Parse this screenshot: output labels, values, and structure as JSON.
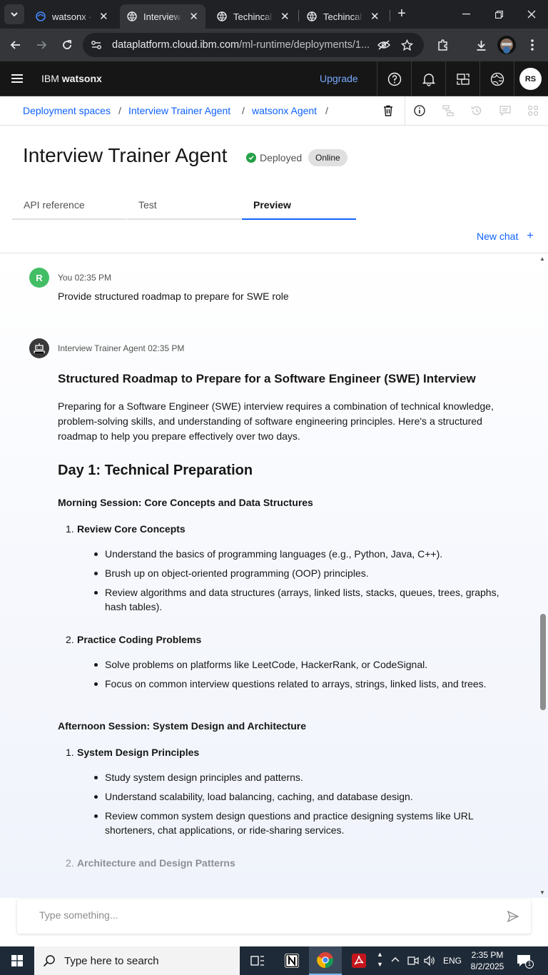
{
  "browser": {
    "tabs": [
      {
        "title": "watsonx - IBM"
      },
      {
        "title": "Interview Trainer Agent"
      },
      {
        "title": "Techincal Interview"
      },
      {
        "title": "Techincal Interview"
      }
    ],
    "url_host": "dataplatform.cloud.ibm.com",
    "url_path": "/ml-runtime/deployments/1..."
  },
  "app_header": {
    "brand_prefix": "IBM",
    "brand_name": "watsonx",
    "upgrade_label": "Upgrade",
    "avatar_initials": "RS"
  },
  "breadcrumb": [
    {
      "label": "Deployment spaces"
    },
    {
      "label": "Interview Trainer Agent"
    },
    {
      "label": "watsonx Agent"
    }
  ],
  "breadcrumb_sep": "/",
  "page": {
    "title": "Interview Trainer Agent",
    "status": "Deployed",
    "tag": "Online",
    "tabs": [
      "API reference",
      "Test",
      "Preview"
    ],
    "new_chat_label": "New chat"
  },
  "chat": {
    "user_avatar": "R",
    "user_meta": "You 02:35 PM",
    "user_message": "Provide structured roadmap to prepare for SWE role",
    "agent_meta": "Interview Trainer Agent 02:35 PM",
    "answer": {
      "heading": "Structured Roadmap to Prepare for a Software Engineer (SWE) Interview",
      "intro": "Preparing for a Software Engineer (SWE) interview requires a combination of technical knowledge, problem-solving skills, and understanding of software engineering principles. Here's a structured roadmap to help you prepare effectively over two days.",
      "day1": "Day 1: Technical Preparation",
      "morning": "Morning Session: Core Concepts and Data Structures",
      "m1_num": "1.",
      "m1_title": "Review Core Concepts",
      "m1_items": [
        "Understand the basics of programming languages (e.g., Python, Java, C++).",
        "Brush up on object-oriented programming (OOP) principles.",
        "Review algorithms and data structures (arrays, linked lists, stacks, queues, trees, graphs, hash tables)."
      ],
      "m2_num": "2.",
      "m2_title": "Practice Coding Problems",
      "m2_items": [
        "Solve problems on platforms like LeetCode, HackerRank, or CodeSignal.",
        "Focus on common interview questions related to arrays, strings, linked lists, and trees."
      ],
      "afternoon": "Afternoon Session: System Design and Architecture",
      "a1_num": "1.",
      "a1_title": "System Design Principles",
      "a1_items": [
        "Study system design principles and patterns.",
        "Understand scalability, load balancing, caching, and database design.",
        "Review common system design questions and practice designing systems like URL shorteners, chat applications, or ride-sharing services."
      ],
      "a2_num": "2.",
      "a2_title": "Architecture and Design Patterns"
    },
    "input_placeholder": "Type something..."
  },
  "taskbar": {
    "search_placeholder": "Type here to search",
    "lang": "ENG",
    "time": "2:35 PM",
    "date": "8/2/2025",
    "notif_count": "1"
  },
  "colors": {
    "accent": "#0f62fe",
    "upgrade": "#78a9ff",
    "deployed_green": "#24a148",
    "user_avatar": "#42be65"
  }
}
